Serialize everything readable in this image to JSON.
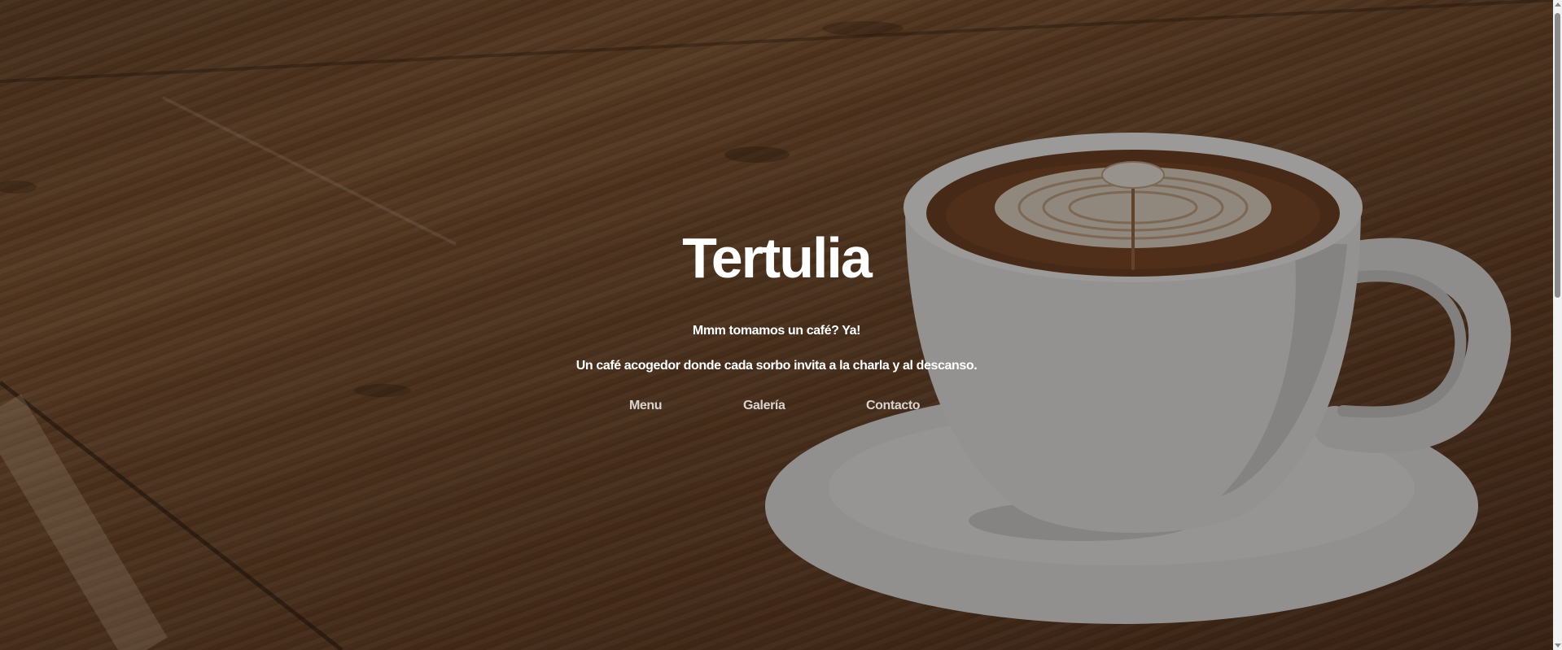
{
  "hero": {
    "title": "Tertulia",
    "tagline": "Mmm tomamos un café? Ya!",
    "description": "Un café acogedor donde cada sorbo invita a la charla y al descanso.",
    "background_image": "coffee-cup-on-wooden-table"
  },
  "nav": {
    "items": [
      {
        "label": "Menu"
      },
      {
        "label": "Galería"
      },
      {
        "label": "Contacto"
      }
    ]
  },
  "colors": {
    "text": "#ffffff",
    "nav_text": "#d9d4cf",
    "overlay": "rgba(20,14,10,0.42)"
  }
}
